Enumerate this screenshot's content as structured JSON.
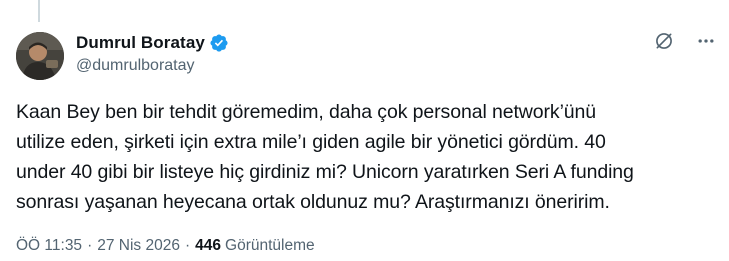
{
  "tweet": {
    "author": {
      "display_name": "Dumrul Boratay",
      "handle": "@dumrulboratay",
      "verified": true,
      "verified_color": "#1d9bf0"
    },
    "text": "Kaan Bey ben bir tehdit göremedim, daha çok personal network’ünü\nutilize eden, şirketi için extra mile’ı giden agile bir yönetici gördüm. 40\nunder 40 gibi bir listeye hiç girdiniz mi? Unicorn yaratırken Seri A funding\nsonrası yaşanan heyecana ortak oldunuz mu? Araştırmanızı öneririm.",
    "time": "ÖÖ 11:35",
    "date": "27 Nis 2026",
    "separator": "·",
    "views_count": "446",
    "views_label": "Görüntüleme"
  },
  "icons": {
    "grok": "grok-icon",
    "more": "more-icon",
    "verified": "verified-badge-icon"
  },
  "colors": {
    "text_primary": "#0f1419",
    "text_secondary": "#536471",
    "thread_line": "#cfd9de"
  }
}
